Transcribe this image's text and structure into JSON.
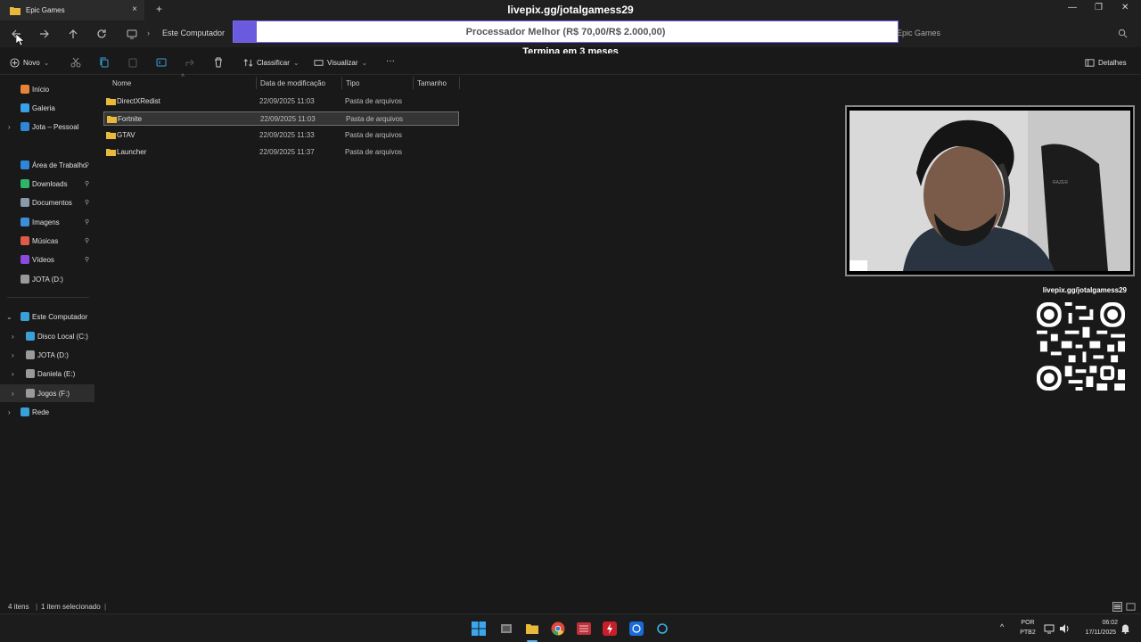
{
  "window": {
    "tab_title": "Epic Games",
    "tab_close": "×",
    "new_tab": "+",
    "controls": {
      "minimize": "—",
      "maximize": "❐",
      "close": "✕"
    }
  },
  "overlay": {
    "url": "livepix.gg/jotalgamess29",
    "goal_text": "Processador Melhor (R$ 70,00/R$ 2.000,00)",
    "goal_progress": 0.035,
    "goal_subtitle": "Termina em 3 meses",
    "qr_url": "livepix.gg/jotalgamess29",
    "progress_color": "#6a5ae0"
  },
  "navbar": {
    "breadcrumb_sep": "›",
    "breadcrumb_root": "Este Computador",
    "search_placeholder": "Epic Games"
  },
  "commandbar": {
    "new_label": "Novo",
    "sort_label": "Classificar",
    "view_label": "Visualizar",
    "more_label": "···",
    "details_label": "Detalhes"
  },
  "sidebar": {
    "quick": [
      {
        "label": "Início",
        "icon": "home-icon",
        "color": "#e8833a"
      },
      {
        "label": "Galeria",
        "icon": "gallery-icon",
        "color": "#3aa0e8"
      },
      {
        "label": "Jota – Pessoal",
        "icon": "cloud-icon",
        "color": "#2f86d8"
      }
    ],
    "pinned": [
      {
        "label": "Área de Trabalho",
        "icon": "desktop-icon",
        "color": "#2f86d8"
      },
      {
        "label": "Downloads",
        "icon": "download-icon",
        "color": "#2fb56a"
      },
      {
        "label": "Documentos",
        "icon": "document-icon",
        "color": "#8a9aad"
      },
      {
        "label": "Imagens",
        "icon": "image-icon",
        "color": "#3a8fd8"
      },
      {
        "label": "Músicas",
        "icon": "music-icon",
        "color": "#e05a4a"
      },
      {
        "label": "Vídeos",
        "icon": "video-icon",
        "color": "#8a4ae0"
      },
      {
        "label": "JOTA (D:)",
        "icon": "drive-icon",
        "color": "#9a9a9a"
      }
    ],
    "computer": {
      "label": "Este Computador",
      "icon": "computer-icon",
      "color": "#3aa0d8"
    },
    "drives": [
      {
        "label": "Disco Local (C:)",
        "color": "#3aa0d8"
      },
      {
        "label": "JOTA (D:)",
        "color": "#9a9a9a"
      },
      {
        "label": "Daniela (E:)",
        "color": "#9a9a9a"
      },
      {
        "label": "Jogos (F:)",
        "color": "#9a9a9a"
      }
    ],
    "network": {
      "label": "Rede",
      "color": "#3aa0d8"
    },
    "pin_glyph": "📌",
    "chev_right": "›",
    "chev_down": "⌄"
  },
  "filelist": {
    "columns": [
      "Nome",
      "Data de modificação",
      "Tipo",
      "Tamanho"
    ],
    "rows": [
      {
        "name": "DirectXRedist",
        "date": "22/09/2025 11:03",
        "type": "Pasta de arquivos",
        "selected": false
      },
      {
        "name": "Fortnite",
        "date": "22/09/2025 11:03",
        "type": "Pasta de arquivos",
        "selected": true
      },
      {
        "name": "GTAV",
        "date": "22/09/2025 11:33",
        "type": "Pasta de arquivos",
        "selected": false
      },
      {
        "name": "Launcher",
        "date": "22/09/2025 11:37",
        "type": "Pasta de arquivos",
        "selected": false
      }
    ]
  },
  "status": {
    "items": "4 itens",
    "selected": "1 item selecionado"
  },
  "taskbar": {
    "lang": "POR",
    "layout": "PTB2",
    "time": "06:02",
    "date": "17/11/2025",
    "tray_arrow": "^"
  }
}
